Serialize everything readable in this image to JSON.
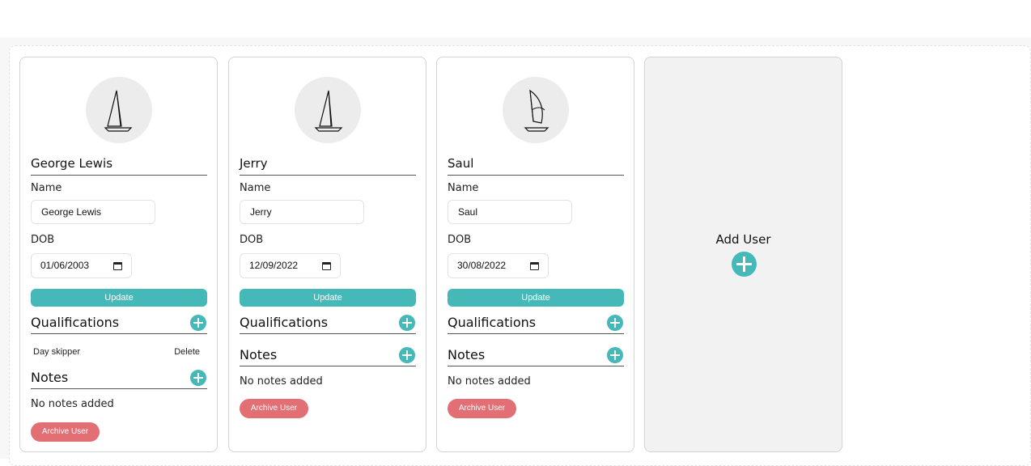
{
  "labels": {
    "name": "Name",
    "dob": "DOB",
    "update": "Update",
    "qualifications": "Qualifications",
    "notes": "Notes",
    "archive": "Archive User",
    "delete": "Delete",
    "no_notes": "No notes added"
  },
  "users": [
    {
      "display_name": "George Lewis",
      "name_value": "George Lewis",
      "dob_value": "01/06/2003",
      "avatar_icon": "sailboat-icon",
      "qualifications": [
        {
          "title": "Day skipper"
        }
      ]
    },
    {
      "display_name": "Jerry",
      "name_value": "Jerry",
      "dob_value": "12/09/2022",
      "avatar_icon": "sailboat-icon",
      "qualifications": []
    },
    {
      "display_name": "Saul",
      "name_value": "Saul",
      "dob_value": "30/08/2022",
      "avatar_icon": "windsurf-icon",
      "qualifications": []
    }
  ],
  "add_user": {
    "label": "Add User"
  },
  "colors": {
    "accent": "#45b8b8",
    "archive": "#e16f74",
    "avatar_bg": "#ececec",
    "add_card_bg": "#f2f2f2"
  }
}
